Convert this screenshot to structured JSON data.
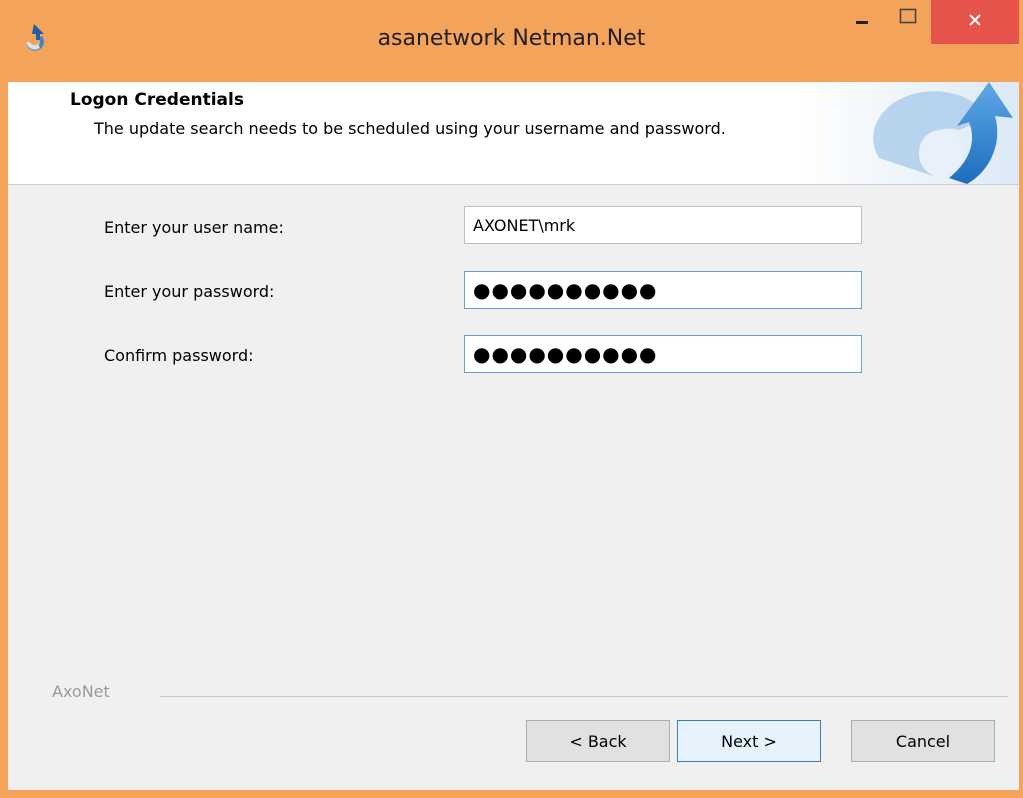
{
  "window": {
    "title": "asanetwork Netman.Net",
    "accent": "#F4A45A",
    "close_color": "#E5534B"
  },
  "header": {
    "title": "Logon Credentials",
    "description": "The update search needs to be scheduled using your username and password."
  },
  "form": {
    "username_label": "Enter your user name:",
    "username_value": "AXONET\\mrk",
    "password_label": "Enter your password:",
    "password_value": "●●●●●●●●●●",
    "confirm_label": "Confirm password:",
    "confirm_value": "●●●●●●●●●●"
  },
  "footer": {
    "brand": "AxoNet",
    "back_label": "< Back",
    "next_label": "Next >",
    "cancel_label": "Cancel"
  },
  "icons": [
    "app-icon",
    "minimize-icon",
    "maximize-icon",
    "close-icon",
    "update-arrow-icon"
  ]
}
